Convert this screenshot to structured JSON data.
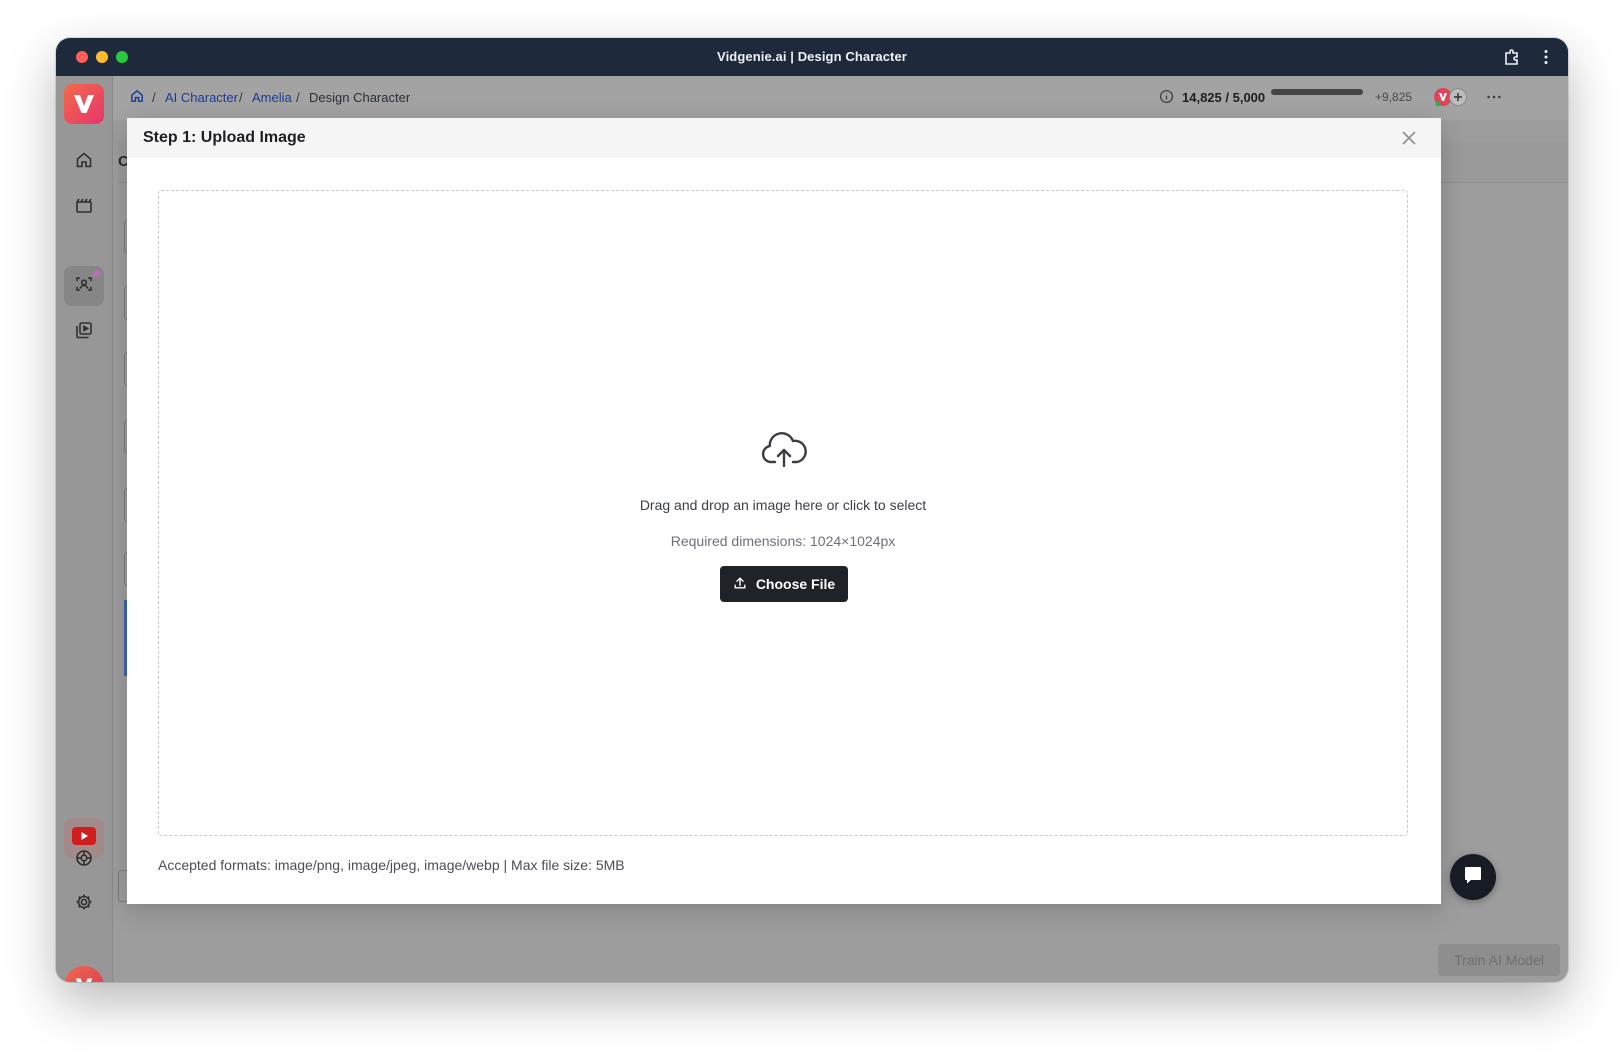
{
  "window": {
    "title": "Vidgenie.ai | Design Character"
  },
  "breadcrumb": {
    "items": [
      {
        "label": "AI Character"
      },
      {
        "label": "Amelia"
      },
      {
        "label": "Design Character"
      }
    ],
    "separator": "/"
  },
  "credits": {
    "used_label": "14,825 / 5,000",
    "bonus_label": "+9,825"
  },
  "background_form": {
    "heading_initial": "C",
    "train_button_label": "Train AI Model"
  },
  "modal": {
    "title": "Step 1: Upload Image",
    "dropzone": {
      "main_text": "Drag and drop an image here or click to select",
      "sub_text": "Required dimensions: 1024×1024px",
      "button_label": "Choose File"
    },
    "footer_text": "Accepted formats: image/png, image/jpeg, image/webp | Max file size: 5MB"
  },
  "colors": {
    "titlebar": "#1e2a3b",
    "brand_gradient_start": "#f26a4a",
    "brand_gradient_end": "#e8356b",
    "primary_button": "#1f2327",
    "link": "#1a3a9a"
  },
  "icons": {
    "sidebar": [
      "home-icon",
      "clapperboard-icon",
      "character-scan-icon",
      "video-library-icon",
      "youtube-icon",
      "support-icon",
      "gear-icon"
    ],
    "modal": [
      "cloud-upload-icon",
      "upload-icon",
      "close-icon"
    ]
  }
}
